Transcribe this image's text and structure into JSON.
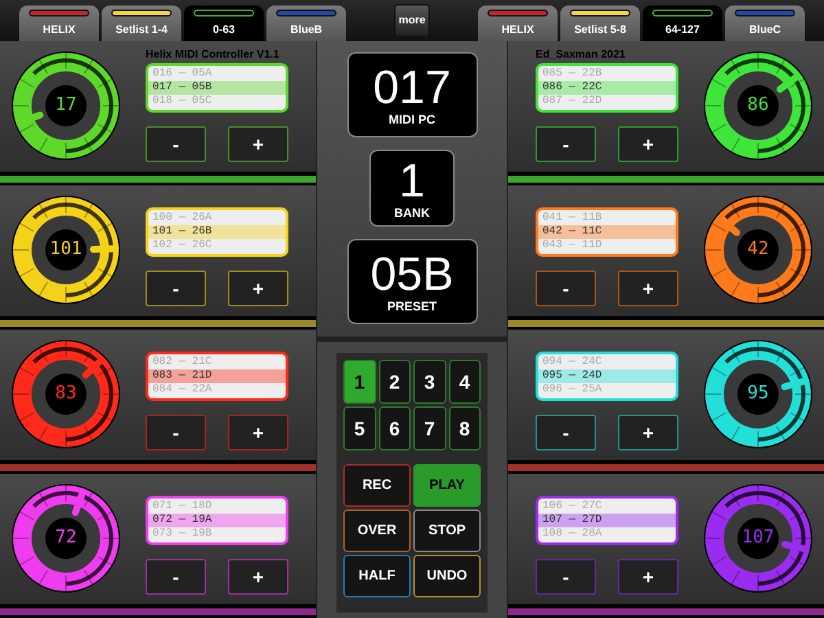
{
  "tabs_left": [
    {
      "label": "HELIX",
      "color": "#c0262b",
      "selected": false
    },
    {
      "label": "Setlist 1-4",
      "color": "#f2d53a",
      "selected": false
    },
    {
      "label": "0-63",
      "color": "#3fb43a",
      "selected": true
    },
    {
      "label": "BlueB",
      "color": "#2446a8",
      "selected": false
    }
  ],
  "more_button": "more",
  "tabs_right": [
    {
      "label": "HELIX",
      "color": "#c0262b",
      "selected": false
    },
    {
      "label": "Setlist 5-8",
      "color": "#f2d53a",
      "selected": false
    },
    {
      "label": "64-127",
      "color": "#3fb43a",
      "selected": true
    },
    {
      "label": "BlueC",
      "color": "#2446a8",
      "selected": false
    }
  ],
  "left_panels": [
    {
      "title": "Helix MIDI Controller  V1.1",
      "value": "17",
      "color": "#5fd82c",
      "stripe": {
        "color": "#3aa52a"
      },
      "lines": [
        {
          "text": "016 — 05A",
          "selected": false
        },
        {
          "text": "017 — 05B",
          "selected": true
        },
        {
          "text": "018 — 05C",
          "selected": false
        }
      ],
      "minus": "-",
      "plus": "+"
    },
    {
      "value": "101",
      "color": "#f5d21a",
      "stripe": {
        "color": "#9c8a2a"
      },
      "lines": [
        {
          "text": "100 — 26A",
          "selected": false
        },
        {
          "text": "101 — 26B",
          "selected": true
        },
        {
          "text": "102 — 26C",
          "selected": false
        }
      ],
      "minus": "-",
      "plus": "+"
    },
    {
      "value": "83",
      "color": "#ff2a1a",
      "stripe": {
        "color": "#a3302a"
      },
      "lines": [
        {
          "text": "082 — 21C",
          "selected": false
        },
        {
          "text": "083 — 21D",
          "selected": true
        },
        {
          "text": "084 — 22A",
          "selected": false
        }
      ],
      "minus": "-",
      "plus": "+"
    },
    {
      "value": "72",
      "color": "#ee3cee",
      "stripe": {
        "color": "#8e2a8e"
      },
      "lines": [
        {
          "text": "071 — 18D",
          "selected": false
        },
        {
          "text": "072 — 19A",
          "selected": true
        },
        {
          "text": "073 — 19B",
          "selected": false
        }
      ],
      "minus": "-",
      "plus": "+"
    }
  ],
  "right_panels": [
    {
      "title": "Ed_Saxman 2021",
      "value": "86",
      "color": "#3fe53a",
      "stripe": {
        "color": "#3aa52a"
      },
      "lines": [
        {
          "text": "085 — 22B",
          "selected": false
        },
        {
          "text": "086 — 22C",
          "selected": true
        },
        {
          "text": "087 — 22D",
          "selected": false
        }
      ],
      "minus": "-",
      "plus": "+"
    },
    {
      "value": "42",
      "color": "#ff7a1a",
      "stripe": {
        "color": "#9c8a2a"
      },
      "lines": [
        {
          "text": "041 — 11B",
          "selected": false
        },
        {
          "text": "042 — 11C",
          "selected": true
        },
        {
          "text": "043 — 11D",
          "selected": false
        }
      ],
      "minus": "-",
      "plus": "+"
    },
    {
      "value": "95",
      "color": "#22e0d8",
      "stripe": {
        "color": "#a3302a"
      },
      "lines": [
        {
          "text": "094 — 24C",
          "selected": false
        },
        {
          "text": "095 — 24D",
          "selected": true
        },
        {
          "text": "096 — 25A",
          "selected": false
        }
      ],
      "minus": "-",
      "plus": "+"
    },
    {
      "value": "107",
      "color": "#9a2cf0",
      "stripe": {
        "color": "#8e2a8e"
      },
      "lines": [
        {
          "text": "106 — 27C",
          "selected": false
        },
        {
          "text": "107 — 27D",
          "selected": true
        },
        {
          "text": "108 — 28A",
          "selected": false
        }
      ],
      "minus": "-",
      "plus": "+"
    }
  ],
  "displays": [
    {
      "value": "017",
      "label": "MIDI PC",
      "kind": "wide"
    },
    {
      "value": "1",
      "label": "BANK",
      "kind": "narrow"
    },
    {
      "value": "05B",
      "label": "PRESET",
      "kind": "wide"
    }
  ],
  "pads": [
    {
      "label": "1",
      "selected": true
    },
    {
      "label": "2",
      "selected": false
    },
    {
      "label": "3",
      "selected": false
    },
    {
      "label": "4",
      "selected": false
    },
    {
      "label": "5",
      "selected": false
    },
    {
      "label": "6",
      "selected": false
    },
    {
      "label": "7",
      "selected": false
    },
    {
      "label": "8",
      "selected": false
    }
  ],
  "transport": [
    {
      "label": "REC",
      "color": "#b02a2a",
      "selected": false
    },
    {
      "label": "PLAY",
      "color": "#2a9a2a",
      "selected": true
    },
    {
      "label": "OVER",
      "color": "#b0602a",
      "selected": false
    },
    {
      "label": "STOP",
      "color": "#8a8a8a",
      "selected": false
    },
    {
      "label": "HALF",
      "color": "#2a7ab0",
      "selected": false
    },
    {
      "label": "UNDO",
      "color": "#b0902a",
      "selected": false
    }
  ]
}
